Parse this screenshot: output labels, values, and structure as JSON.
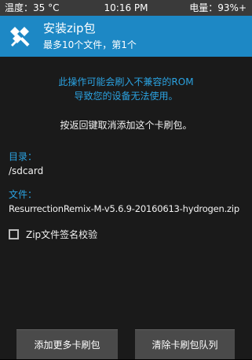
{
  "status_bar": {
    "temperature": "温度：35 °C",
    "time": "10:16 PM",
    "battery": "电量：93%+"
  },
  "header": {
    "title": "安装zip包",
    "subtitle": "最多10个文件，第1个",
    "logo_icon": "twrp-logo-icon"
  },
  "main": {
    "warning_line1": "此操作可能会刷入不兼容的ROM",
    "warning_line2": "导致您的设备无法使用。",
    "notice": "按返回键取消添加这个卡刷包。",
    "directory_label": "目录：",
    "directory_value": "/sdcard",
    "file_label": "文件：",
    "file_value": "ResurrectionRemix-M-v5.6.9-20160613-hydrogen.zip",
    "zip_verify_label": "Zip文件签名校验",
    "zip_verify_checked": false
  },
  "buttons": {
    "add_more": "添加更多卡刷包",
    "clear_queue": "清除卡刷包队列"
  },
  "colors": {
    "accent": "#1d88c5",
    "warning_text": "#2ba3e2",
    "background": "#1a1a1a"
  }
}
